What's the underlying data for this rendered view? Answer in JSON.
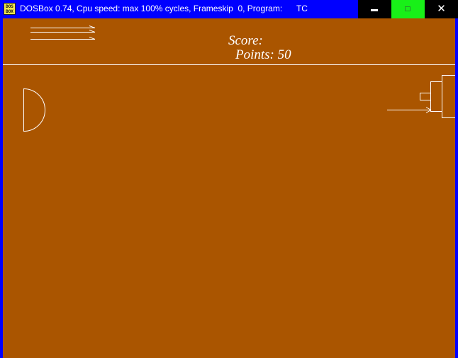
{
  "window": {
    "title": "DOSBox 0.74, Cpu speed: max 100% cycles, Frameskip  0, Program:      TC",
    "icon_text": "DOS\nBOX",
    "icon": "dosbox-icon",
    "controls": {
      "minimize_icon": "minimize-icon",
      "maximize_icon": "maximize-icon",
      "close_glyph": "✕"
    },
    "colors": {
      "titlebar": "#0000ff",
      "maximize_button": "#18f018"
    }
  },
  "game": {
    "background_color": "#aa5500",
    "line_color": "#ffffff",
    "score_label": "Score:",
    "points_label": "Points: 50"
  }
}
